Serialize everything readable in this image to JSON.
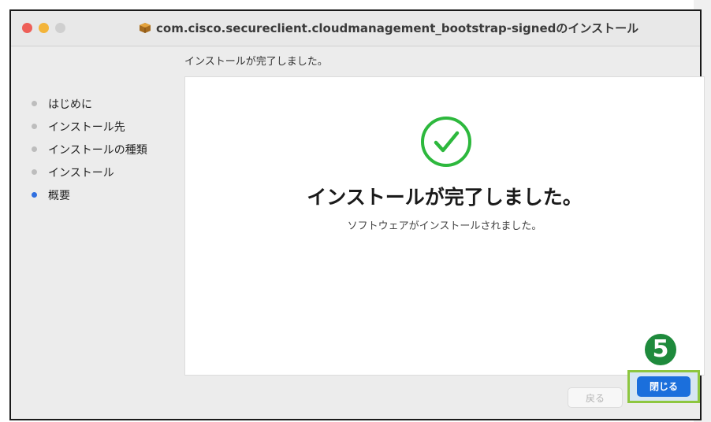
{
  "window": {
    "title": "com.cisco.secureclient.cloudmanagement_bootstrap-signedのインストール",
    "header": "インストールが完了しました。"
  },
  "sidebar": {
    "items": [
      {
        "label": "はじめに",
        "active": false
      },
      {
        "label": "インストール先",
        "active": false
      },
      {
        "label": "インストールの種類",
        "active": false
      },
      {
        "label": "インストール",
        "active": false
      },
      {
        "label": "概要",
        "active": true
      }
    ]
  },
  "main": {
    "title": "インストールが完了しました。",
    "subtitle": "ソフトウェアがインストールされました。"
  },
  "buttons": {
    "back_label": "戻る",
    "close_label": "閉じる"
  },
  "annotation": {
    "step_number": "5"
  },
  "icons": {
    "success": "check-circle-icon",
    "package": "package-icon"
  },
  "colors": {
    "accent": "#1b6fdc",
    "success": "#2db83d",
    "highlight_border": "#8dc63f",
    "badge": "#1e8a3c"
  }
}
